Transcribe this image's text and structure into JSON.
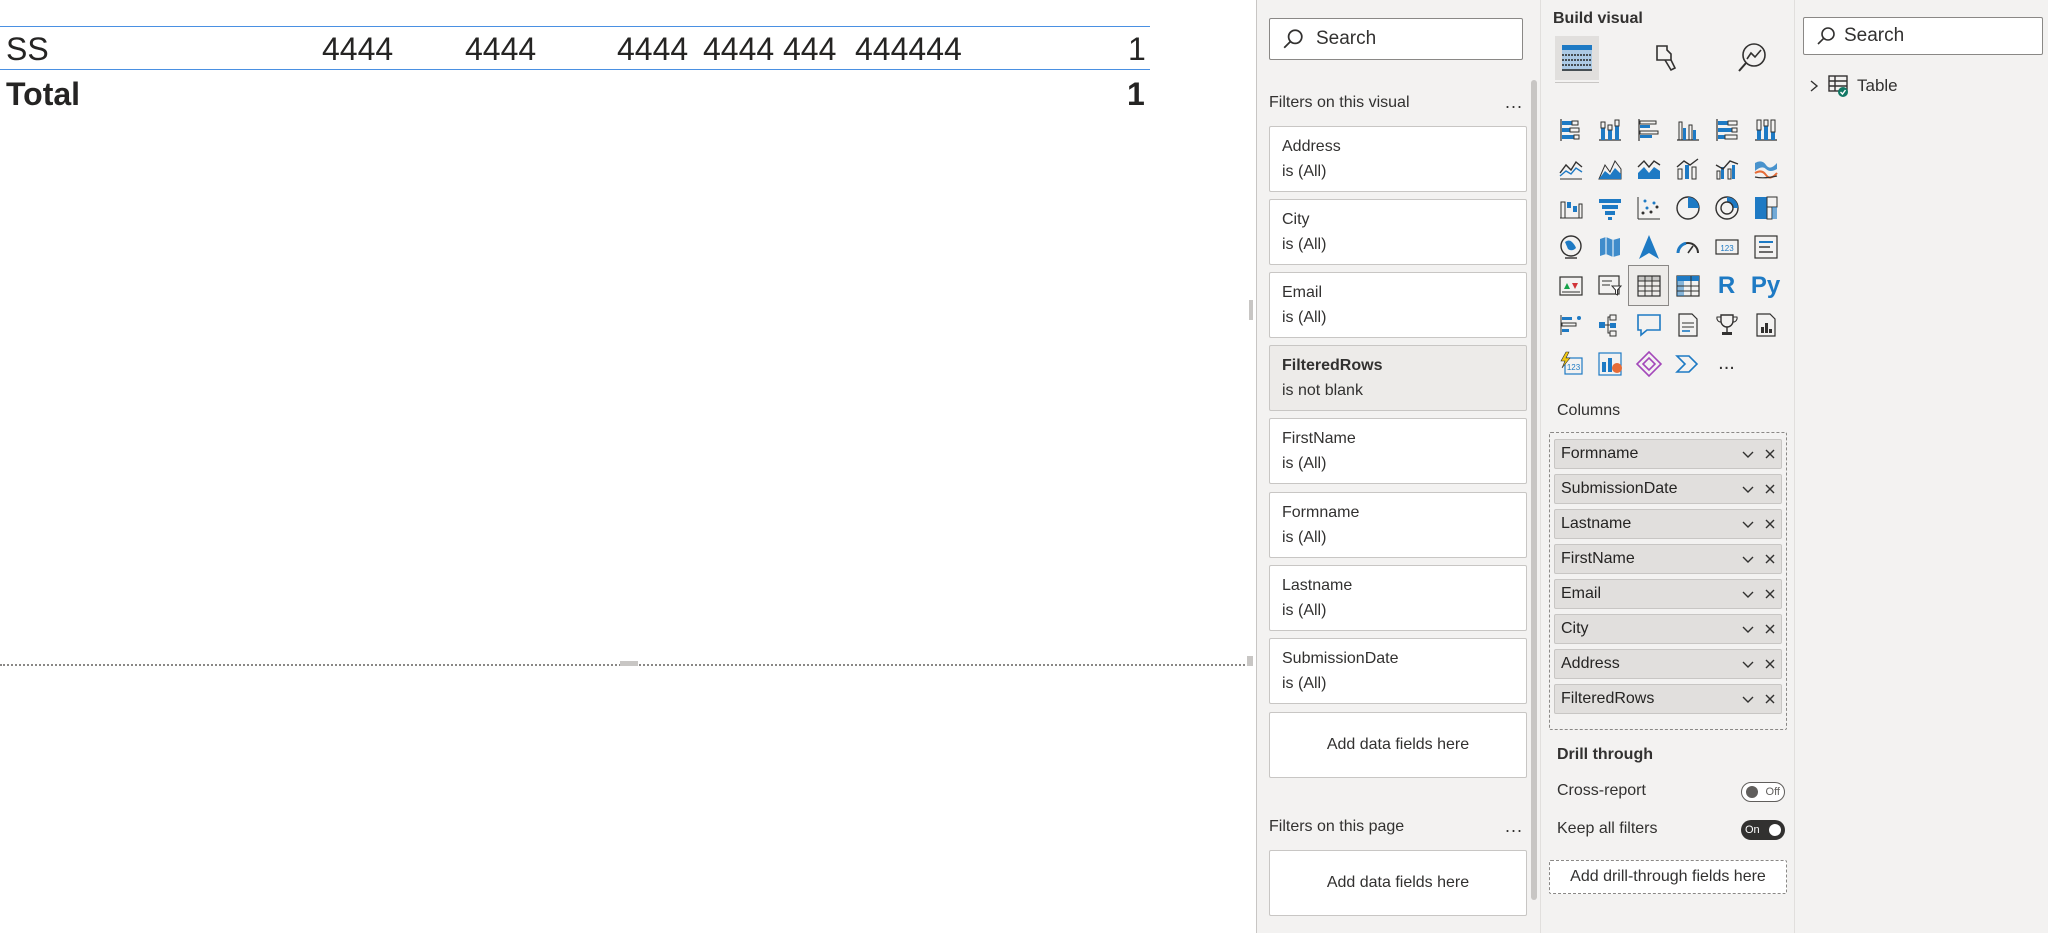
{
  "table": {
    "row": {
      "label": "SS",
      "c1": "4444",
      "c2": "4444",
      "c3": "4444",
      "c4": "4444",
      "c5": "444",
      "c6": "444444",
      "c7": "1"
    },
    "total": {
      "label": "Total",
      "value": "1"
    }
  },
  "filters": {
    "search_placeholder": "Search",
    "visual_section": "Filters on this visual",
    "more": "...",
    "cards": [
      {
        "name": "Address",
        "state": "is (All)"
      },
      {
        "name": "City",
        "state": "is (All)"
      },
      {
        "name": "Email",
        "state": "is (All)"
      },
      {
        "name": "FilteredRows",
        "state": "is not blank"
      },
      {
        "name": "FirstName",
        "state": "is (All)"
      },
      {
        "name": "Formname",
        "state": "is (All)"
      },
      {
        "name": "Lastname",
        "state": "is (All)"
      },
      {
        "name": "SubmissionDate",
        "state": "is (All)"
      }
    ],
    "add_fields": "Add data fields here",
    "page_section": "Filters on this page",
    "page_add_fields": "Add data fields here"
  },
  "visualizations": {
    "title": "Build visual",
    "r_label": "R",
    "py_label": "Py",
    "more_visuals": "...",
    "columns_label": "Columns",
    "columns": [
      "Formname",
      "SubmissionDate",
      "Lastname",
      "FirstName",
      "Email",
      "City",
      "Address",
      "FilteredRows"
    ],
    "drill_through": {
      "title": "Drill through",
      "cross_report": "Cross-report",
      "cross_report_state": "Off",
      "keep_all_filters": "Keep all filters",
      "keep_all_state": "On",
      "add_label": "Add drill-through fields here"
    }
  },
  "data_pane": {
    "search_placeholder": "Search",
    "tables": [
      {
        "name": "Table"
      }
    ]
  },
  "colors": {
    "accent_blue": "#1e7ac4",
    "row_border": "#4a90e2",
    "pane_bg": "#f3f2f1",
    "teal_check": "#117865"
  }
}
